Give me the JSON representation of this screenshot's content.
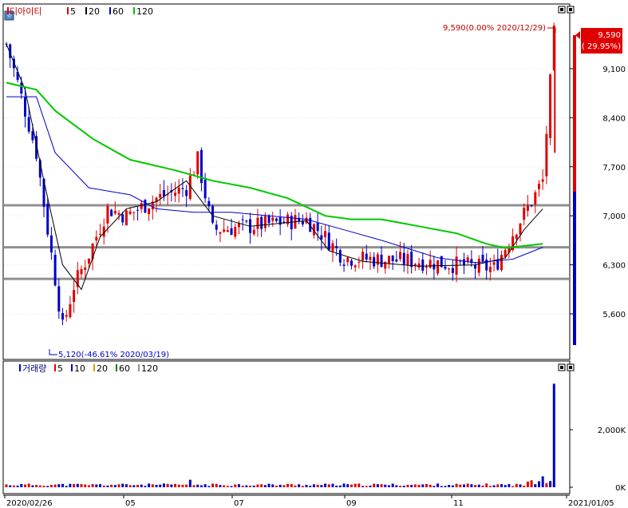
{
  "price_panel": {
    "title": "디아이티",
    "legend": [
      {
        "label": "5",
        "color": "#e00000"
      },
      {
        "label": "20",
        "color": "#000000"
      },
      {
        "label": "60",
        "color": "#0000c8"
      },
      {
        "label": "120",
        "color": "#00c800"
      }
    ],
    "last_price_label": "9,590",
    "last_change_label": "( 29.95%)",
    "high_annotation": "9,590(0.00% 2020/12/29)",
    "low_annotation": "5,120(-46.61% 2020/03/19)"
  },
  "volume_panel": {
    "title": "거래량",
    "legend": [
      {
        "label": "5",
        "color": "#e00000"
      },
      {
        "label": "10",
        "color": "#0000c8"
      },
      {
        "label": "20",
        "color": "#d8a000"
      },
      {
        "label": "60",
        "color": "#008000"
      },
      {
        "label": "120",
        "color": "#909090"
      }
    ]
  },
  "x_axis_labels": [
    "2020/02/26",
    "05",
    "07",
    "09",
    "11",
    "2021/01/05"
  ],
  "icons": {
    "settings": "settings-icon",
    "window_restore": "window-restore-icon",
    "window_close": "window-close-icon"
  },
  "chart_data": {
    "type": "candlestick",
    "x_range": [
      "2020/02/26",
      "2021/01/05"
    ],
    "price_axis": {
      "ticks": [
        5600,
        6300,
        7000,
        7700,
        8400,
        9100
      ],
      "tick_labels": [
        "5,600",
        "6,300",
        "7,000",
        "7,700",
        "8,400",
        "9,100"
      ],
      "ylim": [
        4900,
        10050
      ]
    },
    "volume_axis": {
      "ticks": [
        0,
        2000
      ],
      "tick_labels": [
        "0K",
        "2,000K"
      ],
      "ylim": [
        0,
        3700
      ]
    },
    "horizontal_lines": [
      7150,
      6550,
      6100
    ],
    "series": [
      {
        "name": "5",
        "color": "#e00000",
        "points": [
          [
            0,
            9450
          ],
          [
            3,
            8900
          ],
          [
            8,
            7900
          ],
          [
            11,
            6800
          ],
          [
            15,
            5400
          ],
          [
            18,
            6000
          ],
          [
            22,
            6450
          ],
          [
            27,
            7100
          ],
          [
            32,
            7000
          ],
          [
            40,
            7250
          ],
          [
            48,
            7400
          ],
          [
            51,
            7800
          ],
          [
            55,
            6800
          ],
          [
            65,
            6850
          ],
          [
            80,
            6950
          ],
          [
            84,
            6750
          ],
          [
            90,
            6400
          ],
          [
            110,
            6350
          ],
          [
            130,
            6250
          ],
          [
            135,
            6750
          ],
          [
            141,
            7300
          ],
          [
            143,
            7500
          ],
          [
            146,
            9590
          ]
        ]
      },
      {
        "name": "20",
        "color": "#000000",
        "points": [
          [
            0,
            9450
          ],
          [
            5,
            8800
          ],
          [
            10,
            7500
          ],
          [
            15,
            6300
          ],
          [
            20,
            5950
          ],
          [
            25,
            6700
          ],
          [
            32,
            7100
          ],
          [
            40,
            7200
          ],
          [
            48,
            7500
          ],
          [
            55,
            7000
          ],
          [
            65,
            6850
          ],
          [
            80,
            6930
          ],
          [
            86,
            6500
          ],
          [
            95,
            6350
          ],
          [
            110,
            6280
          ],
          [
            125,
            6300
          ],
          [
            133,
            6400
          ],
          [
            138,
            6800
          ],
          [
            143,
            7100
          ]
        ]
      },
      {
        "name": "60",
        "color": "#0000c8",
        "points": [
          [
            0,
            8700
          ],
          [
            8,
            8700
          ],
          [
            13,
            7900
          ],
          [
            22,
            7400
          ],
          [
            33,
            7300
          ],
          [
            40,
            7100
          ],
          [
            50,
            7050
          ],
          [
            60,
            7050
          ],
          [
            80,
            6950
          ],
          [
            90,
            6800
          ],
          [
            100,
            6650
          ],
          [
            115,
            6400
          ],
          [
            125,
            6330
          ],
          [
            135,
            6380
          ],
          [
            143,
            6550
          ]
        ]
      },
      {
        "name": "120",
        "color": "#00c800",
        "points": [
          [
            0,
            8900
          ],
          [
            8,
            8800
          ],
          [
            13,
            8500
          ],
          [
            23,
            8100
          ],
          [
            33,
            7800
          ],
          [
            45,
            7650
          ],
          [
            55,
            7500
          ],
          [
            65,
            7400
          ],
          [
            75,
            7250
          ],
          [
            85,
            7000
          ],
          [
            92,
            6950
          ],
          [
            100,
            6950
          ],
          [
            110,
            6850
          ],
          [
            120,
            6750
          ],
          [
            128,
            6600
          ],
          [
            133,
            6540
          ],
          [
            143,
            6600
          ]
        ]
      }
    ],
    "volume_highlights": [
      {
        "x": 146,
        "value": 3600
      }
    ]
  }
}
